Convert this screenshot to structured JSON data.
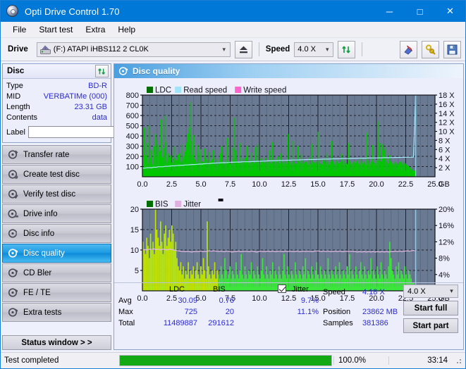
{
  "window": {
    "title": "Opti Drive Control 1.70",
    "icon": "disc-icon",
    "minimize": "─",
    "maximize": "□",
    "close": "✕"
  },
  "menu": {
    "items": [
      "File",
      "Start test",
      "Extra",
      "Help"
    ]
  },
  "toolbar": {
    "drive_label": "Drive",
    "drive_value": "(F:)  ATAPI iHBS112  2 CL0K",
    "eject_title": "Eject",
    "speed_label": "Speed",
    "speed_value": "4.0 X",
    "refresh_title": "Refresh",
    "erase_title": "Erase",
    "tools_title": "Tools",
    "save_title": "Save"
  },
  "disc_panel": {
    "title": "Disc",
    "refresh_icon": "refresh-icon",
    "rows": [
      {
        "key": "Type",
        "value": "BD-R"
      },
      {
        "key": "MID",
        "value": "VERBATIMe (000)"
      },
      {
        "key": "Length",
        "value": "23.31 GB"
      },
      {
        "key": "Contents",
        "value": "data"
      }
    ],
    "label_key": "Label",
    "label_value": "",
    "label_placeholder": ""
  },
  "nav": {
    "items": [
      {
        "label": "Transfer rate",
        "icon": "disc-transfer-icon",
        "active": false
      },
      {
        "label": "Create test disc",
        "icon": "disc-create-icon",
        "active": false
      },
      {
        "label": "Verify test disc",
        "icon": "disc-verify-icon",
        "active": false
      },
      {
        "label": "Drive info",
        "icon": "disc-drive-icon",
        "active": false
      },
      {
        "label": "Disc info",
        "icon": "disc-info-icon",
        "active": false
      },
      {
        "label": "Disc quality",
        "icon": "disc-quality-icon",
        "active": true
      },
      {
        "label": "CD Bler",
        "icon": "disc-bler-icon",
        "active": false
      },
      {
        "label": "FE / TE",
        "icon": "disc-fete-icon",
        "active": false
      },
      {
        "label": "Extra tests",
        "icon": "disc-extra-icon",
        "active": false
      }
    ],
    "status_window": "Status window > >"
  },
  "content": {
    "title": "Disc quality",
    "icon": "disc-quality-icon"
  },
  "stats": {
    "col_ldc": "LDC",
    "col_bis": "BIS",
    "jitter_label": "Jitter",
    "jitter_checked": true,
    "rows": [
      {
        "name": "Avg",
        "ldc": "30.09",
        "bis": "0.76",
        "jitter": "9.7%"
      },
      {
        "name": "Max",
        "ldc": "725",
        "bis": "20",
        "jitter": "11.1%"
      },
      {
        "name": "Total",
        "ldc": "11489887",
        "bis": "291612",
        "jitter": ""
      }
    ],
    "speed_key": "Speed",
    "speed_value": "4.18 X",
    "position_key": "Position",
    "position_value": "23862 MB",
    "samples_key": "Samples",
    "samples_value": "381386",
    "speed_select": "4.0 X",
    "start_full": "Start full",
    "start_part": "Start part"
  },
  "statusbar": {
    "message": "Test completed",
    "progress_percent": 100.0,
    "progress_text": "100.0%",
    "elapsed": "33:14"
  },
  "colors": {
    "accent": "#0078d7",
    "ldc_green": "#00c000",
    "bis_green": "#00c000",
    "jitter_pink": "#e8b8e8",
    "read_speed_cyan": "#9fe4f8",
    "write_speed_magenta": "#ff66cc",
    "plot_bg": "#6b7a93",
    "progress_green": "#14a814",
    "value_blue": "#2b2bd0"
  },
  "chart_data": [
    {
      "type": "area",
      "name": "ldc-chart",
      "title": "",
      "xlabel": "GB",
      "ylabel": "",
      "xlim": [
        0.0,
        25.0
      ],
      "ylim": [
        0,
        800
      ],
      "y2lim": [
        0,
        18
      ],
      "y2label": "X",
      "xticks": [
        0.0,
        2.5,
        5.0,
        7.5,
        10.0,
        12.5,
        15.0,
        17.5,
        20.0,
        22.5,
        25.0
      ],
      "xticklabels": [
        "0.0",
        "2.5",
        "5.0",
        "7.5",
        "10.0",
        "12.5",
        "15.0",
        "17.5",
        "20.0",
        "22.5",
        "25.0"
      ],
      "yticks": [
        100,
        200,
        300,
        400,
        500,
        600,
        700,
        800
      ],
      "yticklabels": [
        "100",
        "200",
        "300",
        "400",
        "500",
        "600",
        "700",
        "800"
      ],
      "y2ticks": [
        2,
        4,
        6,
        8,
        10,
        12,
        14,
        16,
        18
      ],
      "y2ticklabels": [
        "2 X",
        "4 X",
        "6 X",
        "8 X",
        "10 X",
        "12 X",
        "14 X",
        "16 X",
        "18 X"
      ],
      "grid": true,
      "legend": [
        {
          "label": "LDC",
          "color": "#006e00"
        },
        {
          "label": "Read speed",
          "color": "#9fe4f8"
        },
        {
          "label": "Write speed",
          "color": "#ff66cc"
        }
      ],
      "data_end_gb": 23.35,
      "series": [
        {
          "name": "LDC",
          "color": "#00c800",
          "kind": "spikes",
          "baseline": 60,
          "values": [
            95,
            480,
            210,
            330,
            140,
            500,
            180,
            260,
            120,
            300,
            420,
            360,
            200,
            310,
            250,
            560,
            190,
            280,
            600,
            340,
            150,
            230,
            190,
            210,
            140,
            180,
            300,
            175,
            160,
            215,
            230,
            145,
            310,
            170,
            200,
            250,
            330,
            420,
            480,
            730,
            355,
            215,
            410,
            170,
            140,
            310,
            235,
            130,
            270,
            150,
            140,
            275,
            180,
            160,
            120,
            240,
            145,
            170,
            260,
            130,
            110,
            180,
            150,
            125,
            230,
            300,
            140,
            120,
            165,
            145,
            380,
            150,
            130,
            120,
            290,
            170,
            580,
            260,
            150,
            130,
            330,
            140,
            125,
            180,
            150,
            190,
            300,
            140,
            120,
            165,
            235,
            150,
            130,
            290,
            150,
            320,
            140,
            120,
            180,
            155,
            135,
            190,
            150,
            125,
            145,
            260,
            130,
            340,
            150,
            120,
            175,
            150,
            200,
            130,
            230,
            140,
            125,
            165,
            150,
            130,
            420,
            150,
            120,
            145,
            350,
            160,
            130,
            125,
            300,
            150,
            130,
            220,
            160,
            130,
            145,
            150,
            120,
            190,
            130,
            125,
            320,
            145,
            130,
            150,
            125,
            440,
            155,
            130,
            120,
            175,
            150,
            135,
            230,
            150,
            120,
            145,
            350,
            150,
            130,
            120,
            165,
            150,
            130,
            145,
            225,
            150,
            120,
            160,
            135,
            125,
            330,
            150,
            130,
            120,
            145,
            150,
            135,
            160,
            130,
            120,
            185,
            150,
            130,
            150,
            120,
            430,
            160,
            130,
            120,
            150,
            310,
            140,
            125,
            165,
            150,
            545,
            330,
            150,
            320,
            260,
            290,
            180,
            150,
            130,
            215,
            150,
            130,
            120,
            140,
            150,
            130,
            120,
            145,
            150,
            130,
            120,
            150,
            130,
            120,
            110,
            100,
            90,
            80,
            70,
            60,
            50
          ]
        },
        {
          "name": "Read speed",
          "color": "#a6e8fb",
          "kind": "line",
          "axis": "right",
          "values": [
            1.9,
            1.9,
            2.0,
            2.0,
            2.0,
            2.1,
            2.1,
            2.2,
            2.2,
            2.2,
            2.3,
            2.3,
            2.35,
            2.4,
            2.4,
            2.45,
            2.5,
            2.5,
            2.55,
            2.6,
            2.6,
            2.65,
            2.7,
            2.7,
            2.75,
            2.8,
            2.8,
            2.85,
            2.9,
            2.9,
            2.95,
            3.0,
            3.0,
            3.05,
            3.05,
            3.1,
            3.1,
            3.12,
            3.15,
            3.2,
            3.2,
            3.22,
            3.25,
            3.25,
            3.3,
            3.3,
            3.3,
            3.32,
            3.35,
            3.35,
            3.4,
            3.4,
            3.42,
            3.45,
            3.45,
            3.5,
            3.5,
            3.5,
            3.55,
            3.55,
            3.6,
            3.6,
            3.6,
            3.62,
            3.65,
            3.65,
            3.7,
            3.7,
            3.7,
            3.72,
            3.75,
            3.75,
            3.78,
            3.8,
            3.8,
            3.8,
            3.82,
            3.85,
            3.85,
            3.88,
            3.9,
            3.9,
            3.9,
            3.92,
            3.95,
            3.95,
            3.95,
            3.98,
            4.0,
            4.0,
            4.0,
            4.02,
            4.05,
            4.05,
            4.05,
            4.08,
            4.1,
            4.1,
            4.1,
            4.12,
            4.12,
            4.15,
            4.15,
            4.15,
            4.18,
            4.18,
            4.2,
            4.2,
            4.2,
            4.22,
            4.22,
            4.25,
            4.25,
            4.25,
            4.28,
            4.28,
            4.3,
            4.3,
            4.3,
            4.32,
            18.0
          ]
        }
      ]
    },
    {
      "type": "area",
      "name": "bis-chart",
      "title": "",
      "xlabel": "GB",
      "ylabel": "",
      "xlim": [
        0.0,
        25.0
      ],
      "ylim": [
        0,
        20
      ],
      "y2lim": [
        0,
        20
      ],
      "y2label": "%",
      "xticks": [
        0.0,
        2.5,
        5.0,
        7.5,
        10.0,
        12.5,
        15.0,
        17.5,
        20.0,
        22.5,
        25.0
      ],
      "xticklabels": [
        "0.0",
        "2.5",
        "5.0",
        "7.5",
        "10.0",
        "12.5",
        "15.0",
        "17.5",
        "20.0",
        "22.5",
        "25.0"
      ],
      "yticks": [
        5,
        10,
        15,
        20
      ],
      "yticklabels": [
        "5",
        "10",
        "15",
        "20"
      ],
      "y2ticks": [
        4,
        8,
        12,
        16,
        20
      ],
      "y2ticklabels": [
        "4%",
        "8%",
        "12%",
        "16%",
        "20%"
      ],
      "grid": true,
      "legend": [
        {
          "label": "BIS",
          "color": "#006e00"
        },
        {
          "label": "Jitter",
          "color": "#e0b0e0"
        }
      ],
      "data_end_gb": 23.35,
      "series": [
        {
          "name": "BIS",
          "color": "#3ce63c",
          "kind": "spikes",
          "baseline": 1.0,
          "values": [
            12,
            10,
            9,
            13,
            11,
            8,
            14,
            10,
            12,
            9,
            20,
            15,
            13,
            11,
            17,
            12,
            9,
            14,
            16,
            11,
            13,
            15,
            12,
            16,
            14,
            10,
            12,
            8,
            6,
            5,
            7,
            4,
            6,
            3,
            5,
            4,
            7,
            3,
            5,
            4,
            6,
            3,
            5,
            7,
            4,
            3,
            6,
            4,
            8,
            5,
            3,
            17,
            6,
            4,
            3,
            5,
            4,
            7,
            3,
            5,
            4,
            3,
            6,
            4,
            3,
            8,
            5,
            3,
            4,
            6,
            3,
            5,
            4,
            3,
            7,
            4,
            3,
            5,
            9,
            4,
            3,
            6,
            4,
            3,
            5,
            4,
            7,
            3,
            5,
            4,
            3,
            6,
            4,
            3,
            5,
            8,
            4,
            3,
            6,
            4,
            3,
            5,
            4,
            7,
            3,
            5,
            4,
            3,
            6,
            4,
            3,
            5,
            9,
            4,
            3,
            6,
            4,
            3,
            5,
            4,
            3,
            7,
            4,
            3,
            5,
            4,
            3,
            6,
            4,
            8,
            3,
            5,
            4,
            3,
            6,
            4,
            3,
            5,
            7,
            4,
            3,
            6,
            4,
            3,
            5,
            4,
            3,
            8,
            4,
            3,
            5,
            4,
            3,
            6,
            4,
            3,
            7,
            4,
            3,
            5,
            4,
            3,
            6,
            4,
            9,
            3,
            5,
            4,
            3,
            6,
            4,
            3,
            5,
            7,
            4,
            3,
            6,
            4,
            3,
            5,
            4,
            8,
            3,
            5,
            4,
            3,
            6,
            4,
            3,
            7,
            4,
            3,
            5,
            4,
            3,
            6,
            12,
            8,
            5,
            4,
            3,
            6,
            4,
            7,
            3,
            5,
            4,
            3,
            6,
            4,
            3,
            5,
            4,
            3,
            2,
            2,
            1
          ]
        },
        {
          "name": "Jitter",
          "color": "#e6bce6",
          "kind": "line",
          "axis": "right",
          "values": [
            10.0,
            10.1,
            10.0,
            10.2,
            10.1,
            10.3,
            10.1,
            10.2,
            10.0,
            10.2,
            10.1,
            10.0,
            10.2,
            10.1,
            10.0,
            9.9,
            9.8,
            9.7,
            9.6,
            9.6,
            9.6,
            9.6,
            9.5,
            9.6,
            9.6,
            9.6,
            9.7,
            9.6,
            9.6,
            9.7,
            9.8,
            9.7,
            9.8,
            9.7,
            9.6,
            9.7,
            9.6,
            9.6,
            9.7,
            9.6,
            9.5,
            9.6,
            9.6,
            9.7,
            9.6,
            9.6,
            9.7,
            9.6,
            9.6,
            9.7,
            9.6,
            9.5,
            9.6,
            9.7,
            9.6,
            9.6,
            9.7,
            9.6,
            9.7,
            9.6,
            9.6,
            9.7,
            9.6,
            9.6,
            9.7,
            9.6,
            9.7,
            9.6,
            9.6,
            9.7,
            9.6,
            9.6,
            9.7,
            9.6,
            9.7,
            9.6,
            9.6,
            9.7,
            9.8,
            9.7,
            9.6,
            9.7,
            9.6,
            9.7,
            9.6,
            9.6,
            9.7,
            9.6,
            9.7,
            9.6,
            9.6,
            9.7,
            9.6,
            9.7,
            9.6,
            9.6,
            9.5,
            9.6,
            9.5,
            9.6,
            9.5,
            9.6,
            9.5,
            9.6,
            9.5,
            9.6,
            9.5,
            9.6,
            9.5,
            9.6,
            9.5,
            9.6,
            9.6,
            9.7,
            9.6,
            9.7,
            9.6,
            9.7,
            9.8,
            9.7,
            9.8,
            9.9,
            9.8
          ]
        }
      ]
    }
  ]
}
